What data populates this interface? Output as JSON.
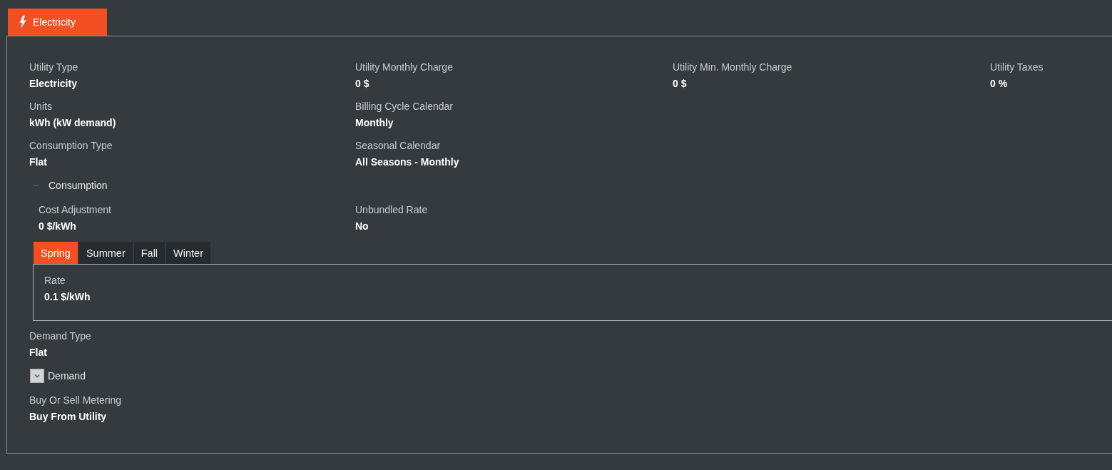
{
  "tabs": [
    {
      "label": "Electricity",
      "selected": true
    }
  ],
  "summary_rows": [
    [
      {
        "label": "Utility Type",
        "value": "Electricity"
      },
      {
        "label": "Utility Monthly Charge",
        "value": "0 $"
      },
      {
        "label": "Utility Min. Monthly Charge",
        "value": "0 $"
      },
      {
        "label": "Utility Taxes",
        "value": "0 %"
      }
    ],
    [
      {
        "label": "Units",
        "value": "kWh (kW demand)"
      },
      {
        "label": "Billing Cycle Calendar",
        "value": "Monthly"
      }
    ],
    [
      {
        "label": "Consumption Type",
        "value": "Flat"
      },
      {
        "label": "Seasonal Calendar",
        "value": "All Seasons - Monthly"
      }
    ]
  ],
  "consumption": {
    "label": "Consumption",
    "expanded": true,
    "fields": [
      {
        "label": "Cost Adjustment",
        "value": "0 $/kWh"
      },
      {
        "label": "Unbundled Rate",
        "value": "No"
      }
    ],
    "season_tabs": [
      {
        "label": "Spring",
        "selected": true
      },
      {
        "label": "Summer",
        "selected": false
      },
      {
        "label": "Fall",
        "selected": false
      },
      {
        "label": "Winter",
        "selected": false
      }
    ],
    "season_fields": [
      {
        "label": "Rate",
        "value": "0.1 $/kWh"
      }
    ]
  },
  "demand_type": {
    "label": "Demand Type",
    "value": "Flat"
  },
  "demand": {
    "label": "Demand",
    "expanded": false
  },
  "metering": {
    "label": "Buy Or Sell Metering",
    "value": "Buy From Utility"
  }
}
